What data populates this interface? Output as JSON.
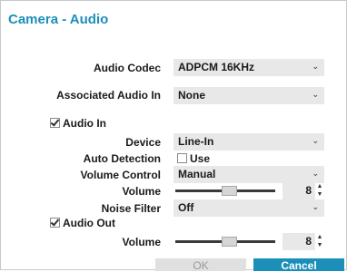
{
  "title": "Camera - Audio",
  "audio_codec": {
    "label": "Audio Codec",
    "value": "ADPCM 16KHz"
  },
  "associated_audio_in": {
    "label": "Associated Audio In",
    "value": "None"
  },
  "audio_in": {
    "label": "Audio In",
    "checked": true,
    "device": {
      "label": "Device",
      "value": "Line-In"
    },
    "auto_detection": {
      "label": "Auto Detection",
      "use_label": "Use",
      "checked": false
    },
    "volume_control": {
      "label": "Volume Control",
      "value": "Manual"
    },
    "volume": {
      "label": "Volume",
      "value": "8",
      "level_fraction": 0.55
    },
    "noise_filter": {
      "label": "Noise Filter",
      "value": "Off"
    }
  },
  "audio_out": {
    "label": "Audio Out",
    "checked": true,
    "volume": {
      "label": "Volume",
      "value": "8",
      "level_fraction": 0.55
    }
  },
  "buttons": {
    "ok": "OK",
    "cancel": "Cancel"
  },
  "colors": {
    "accent": "#1b8fb8",
    "field_bg": "#e8e8e8"
  },
  "icons": {
    "dropdown": "chevron-down-icon",
    "spinner": "spinner-arrows-icon",
    "checkbox": "checkbox-icon"
  }
}
